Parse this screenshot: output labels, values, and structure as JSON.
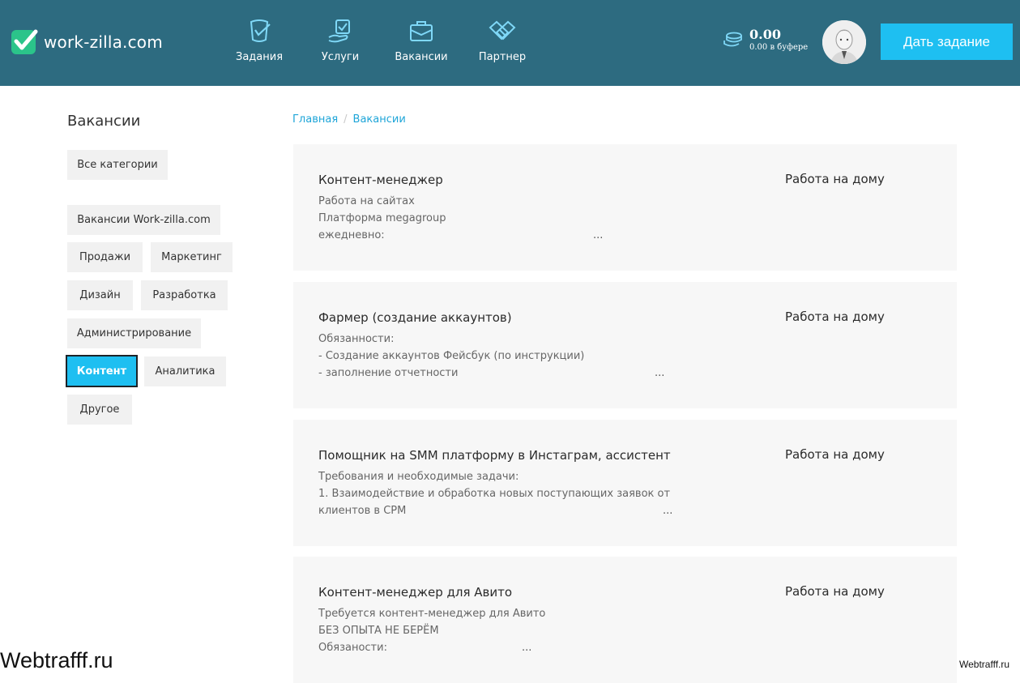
{
  "header": {
    "logo_text": "work-zilla.com",
    "nav": [
      {
        "label": "Задания",
        "icon": "tasks-icon"
      },
      {
        "label": "Услуги",
        "icon": "services-icon"
      },
      {
        "label": "Вакансии",
        "icon": "briefcase-icon"
      },
      {
        "label": "Партнер",
        "icon": "handshake-icon"
      }
    ],
    "balance": {
      "amount": "0.00",
      "buffer": "0.00 в буфере"
    },
    "cta_label": "Дать задание",
    "colors": {
      "header_bg": "#2d6b80",
      "accent": "#1ebff1",
      "logo_green": "#2bc48a"
    }
  },
  "sidebar": {
    "title": "Вакансии",
    "categories": [
      {
        "label": "Все категории"
      },
      {
        "label": "Вакансии Work-zilla.com"
      },
      {
        "label": "Продажи"
      },
      {
        "label": "Маркетинг"
      },
      {
        "label": "Дизайн"
      },
      {
        "label": "Разработка"
      },
      {
        "label": "Администрирование"
      },
      {
        "label": "Контент",
        "active": true
      },
      {
        "label": "Аналитика"
      },
      {
        "label": "Другое"
      }
    ]
  },
  "breadcrumb": {
    "home": "Главная",
    "separator": "/",
    "current": "Вакансии"
  },
  "vacancies": [
    {
      "title": "Контент-менеджер",
      "location": "Работа на дому",
      "lines": [
        "Работа на сайтах",
        "Платформа megagroup",
        "ежедневно:"
      ],
      "ellipsis": "..."
    },
    {
      "title": "Фармер (создание аккаунтов)",
      "location": "Работа на дому",
      "lines": [
        "Обязанности:",
        "- Создание аккаунтов Фейсбук (по инструкции)",
        "- заполнение отчетности"
      ],
      "ellipsis": "..."
    },
    {
      "title": "Помощник на SMM платформу в Инстаграм, ассистент",
      "location": "Работа на дому",
      "lines": [
        "Требования и необходимые задачи:",
        "1. Взаимодействие и обработка новых поступающих заявок от",
        "клиентов в СРМ"
      ],
      "ellipsis": "..."
    },
    {
      "title": "Контент-менеджер для Авито",
      "location": "Работа на дому",
      "lines": [
        "Требуется контент-менеджер для Авито",
        "БЕЗ ОПЫТА НЕ БЕРЁМ",
        "Обязаности:"
      ],
      "ellipsis": "..."
    }
  ],
  "watermark": {
    "left": "Webtrafff.ru",
    "right": "Webtrafff.ru"
  }
}
